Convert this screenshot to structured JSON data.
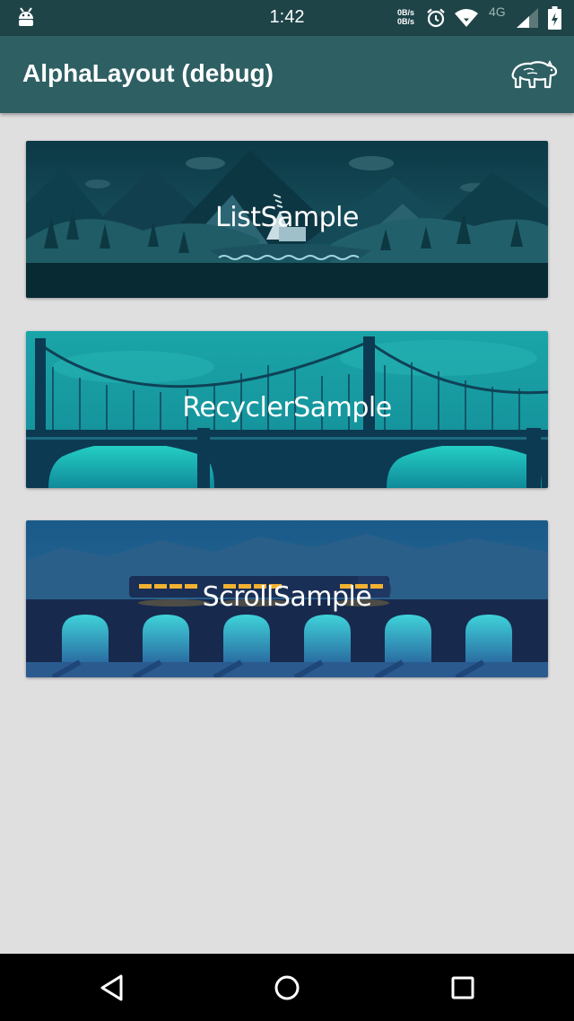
{
  "status_bar": {
    "time": "1:42",
    "net_up": "0B/s",
    "net_down": "0B/s",
    "network_type": "4G"
  },
  "app_bar": {
    "title": "AlphaLayout (debug)",
    "action_icon": "bear-icon"
  },
  "samples": [
    {
      "label": "ListSample",
      "theme": "mountain-lake"
    },
    {
      "label": "RecyclerSample",
      "theme": "suspension-bridge"
    },
    {
      "label": "ScrollSample",
      "theme": "night-train-viaduct"
    }
  ],
  "nav_bar": {
    "back_icon": "back-icon",
    "home_icon": "home-icon",
    "recents_icon": "recents-icon"
  },
  "colors": {
    "status_bar": "#1e4448",
    "app_bar": "#2e5f63",
    "background": "#e0dfe0"
  }
}
